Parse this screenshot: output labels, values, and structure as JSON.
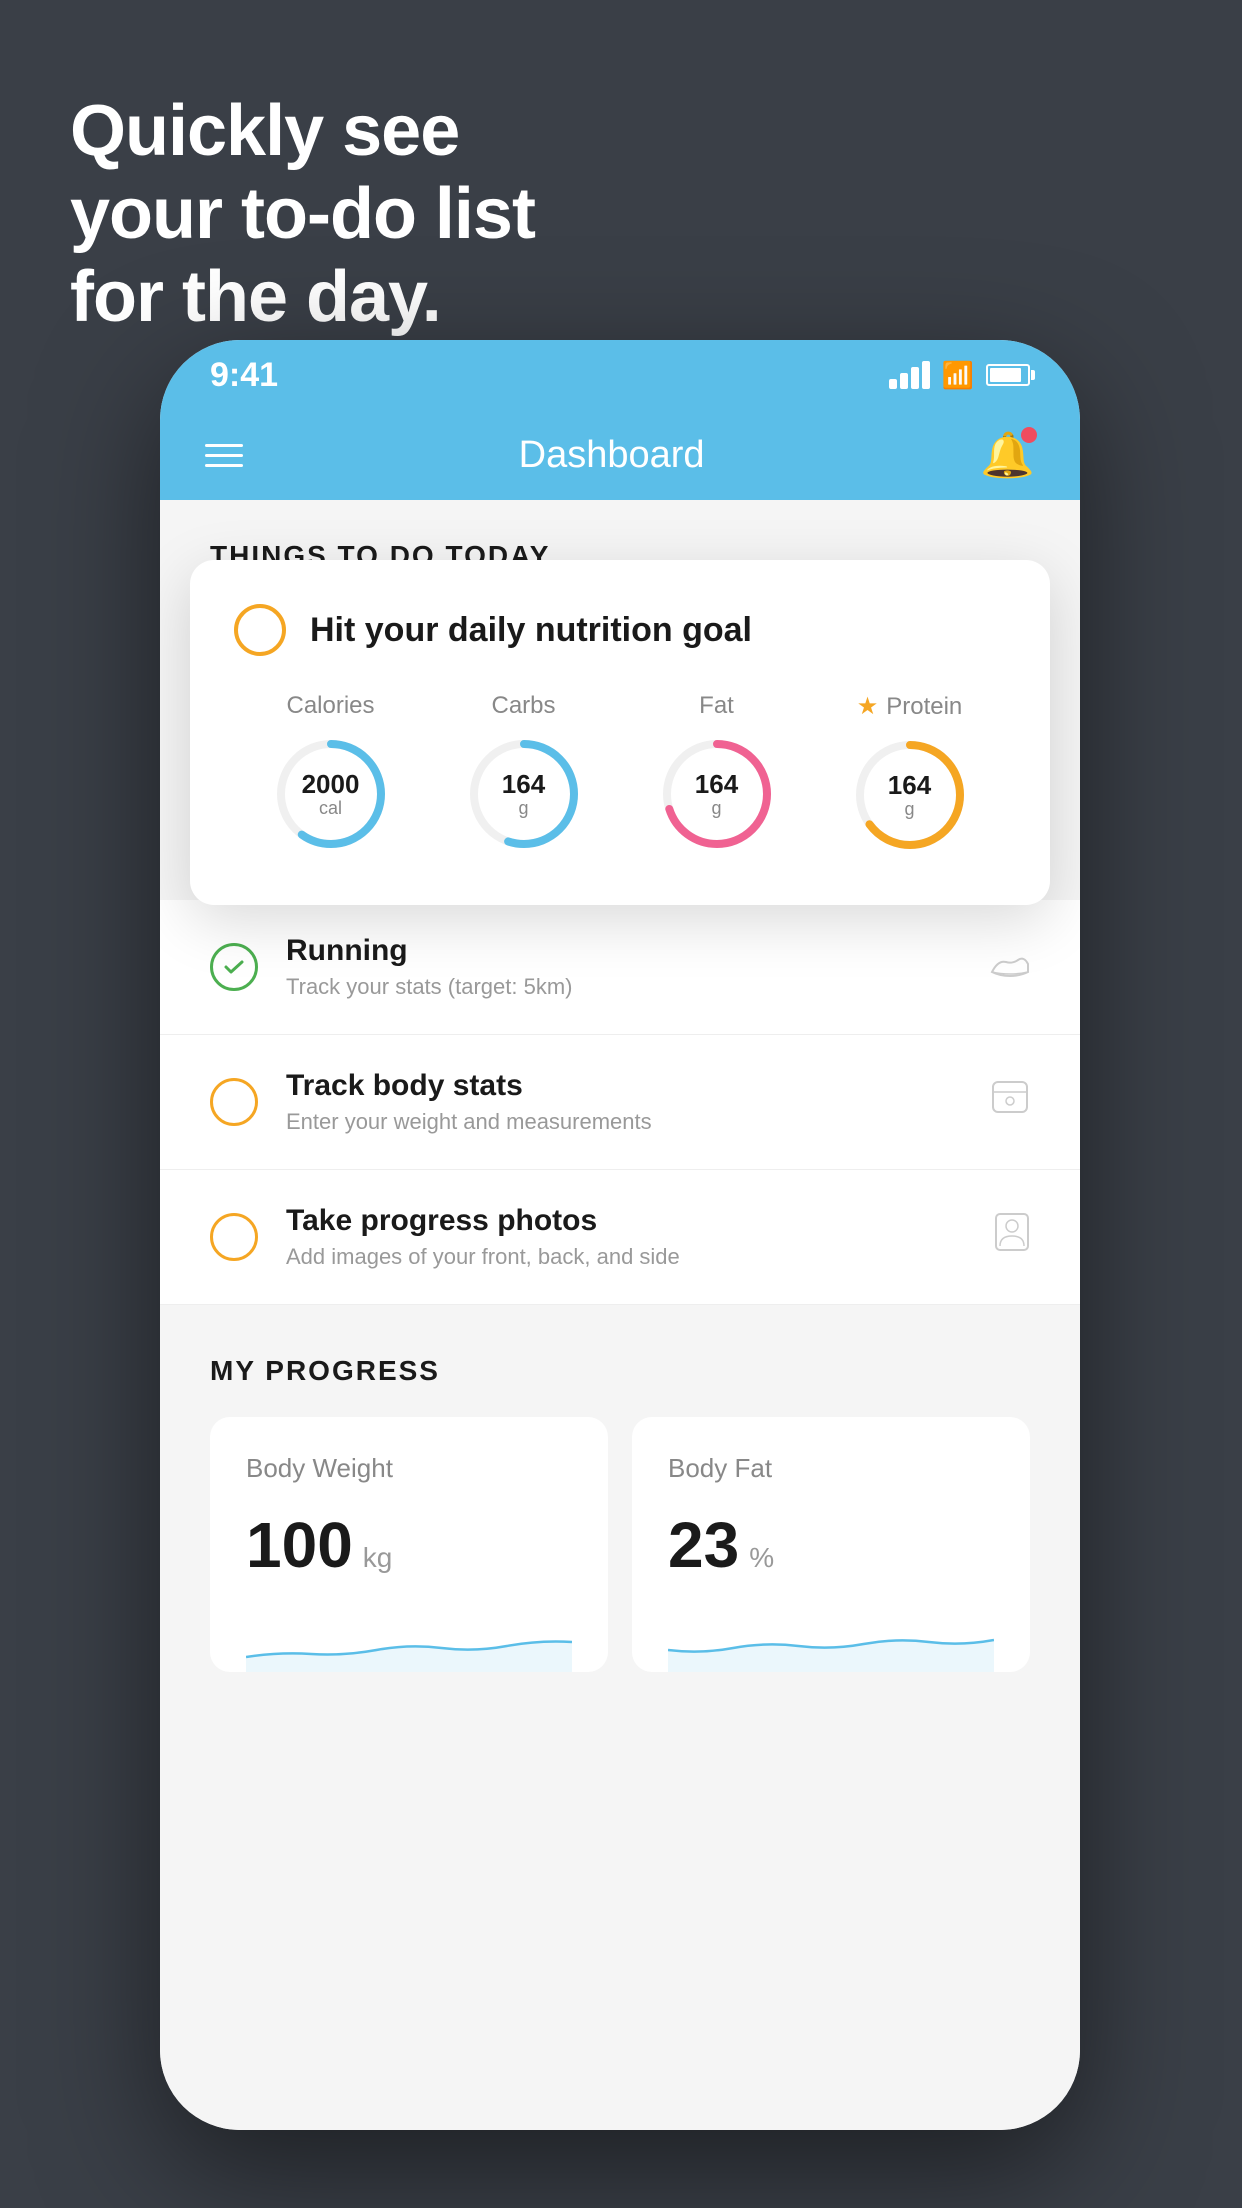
{
  "background": {
    "color": "#3a3f47"
  },
  "headline": {
    "line1": "Quickly see",
    "line2": "your to-do list",
    "line3": "for the day."
  },
  "phone": {
    "statusBar": {
      "time": "9:41",
      "signal": "signal",
      "wifi": "wifi",
      "battery": "battery"
    },
    "navBar": {
      "title": "Dashboard",
      "hamburger": "menu",
      "notification": "notification"
    },
    "todaySection": {
      "title": "THINGS TO DO TODAY"
    },
    "floatingCard": {
      "circleColor": "yellow",
      "title": "Hit your daily nutrition goal",
      "items": [
        {
          "label": "Calories",
          "value": "2000",
          "unit": "cal",
          "color": "blue",
          "percent": 60,
          "starred": false
        },
        {
          "label": "Carbs",
          "value": "164",
          "unit": "g",
          "color": "blue",
          "percent": 55,
          "starred": false
        },
        {
          "label": "Fat",
          "value": "164",
          "unit": "g",
          "color": "pink",
          "percent": 70,
          "starred": false
        },
        {
          "label": "Protein",
          "value": "164",
          "unit": "g",
          "color": "yellow",
          "percent": 65,
          "starred": true
        }
      ]
    },
    "todoList": [
      {
        "id": "running",
        "checkColor": "green",
        "title": "Running",
        "subtitle": "Track your stats (target: 5km)",
        "icon": "shoe"
      },
      {
        "id": "body-stats",
        "checkColor": "yellow",
        "title": "Track body stats",
        "subtitle": "Enter your weight and measurements",
        "icon": "scale"
      },
      {
        "id": "progress-photos",
        "checkColor": "yellow",
        "title": "Take progress photos",
        "subtitle": "Add images of your front, back, and side",
        "icon": "person"
      }
    ],
    "progressSection": {
      "title": "MY PROGRESS",
      "cards": [
        {
          "title": "Body Weight",
          "value": "100",
          "unit": "kg"
        },
        {
          "title": "Body Fat",
          "value": "23",
          "unit": "%"
        }
      ]
    }
  }
}
